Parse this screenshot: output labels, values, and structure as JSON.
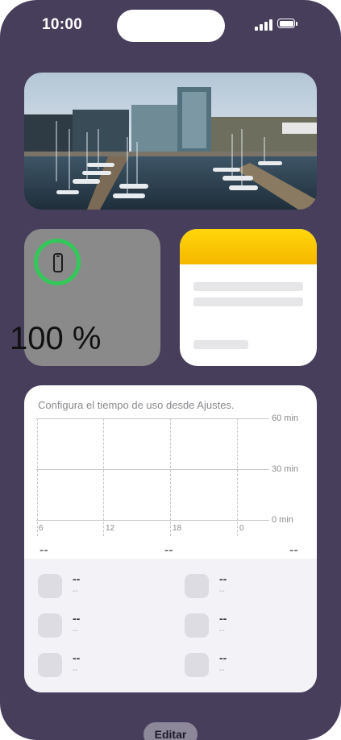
{
  "status_bar": {
    "time": "10:00",
    "icons": [
      "signal-bars-icon",
      "battery-icon"
    ]
  },
  "photo_widget": {
    "subject": "harbor-marina-photo"
  },
  "battery_widget": {
    "percent_label": "100 %",
    "level": 1.0,
    "device_icon": "iphone-icon",
    "ring_color": "#34c759"
  },
  "notes_widget": {
    "accent": "#ffd60a"
  },
  "screen_time": {
    "message": "Configura el tiempo de uso desde Ajustes.",
    "y_labels": [
      "60 min",
      "30 min",
      "0 min"
    ],
    "x_ticks": [
      "6",
      "12",
      "18",
      "0"
    ],
    "summary": [
      "--",
      "--",
      "--"
    ],
    "apps": [
      {
        "name": "--",
        "time": "--"
      },
      {
        "name": "--",
        "time": "--"
      },
      {
        "name": "--",
        "time": "--"
      },
      {
        "name": "--",
        "time": "--"
      },
      {
        "name": "--",
        "time": "--"
      },
      {
        "name": "--",
        "time": "--"
      }
    ]
  },
  "edit_label": "Editar"
}
